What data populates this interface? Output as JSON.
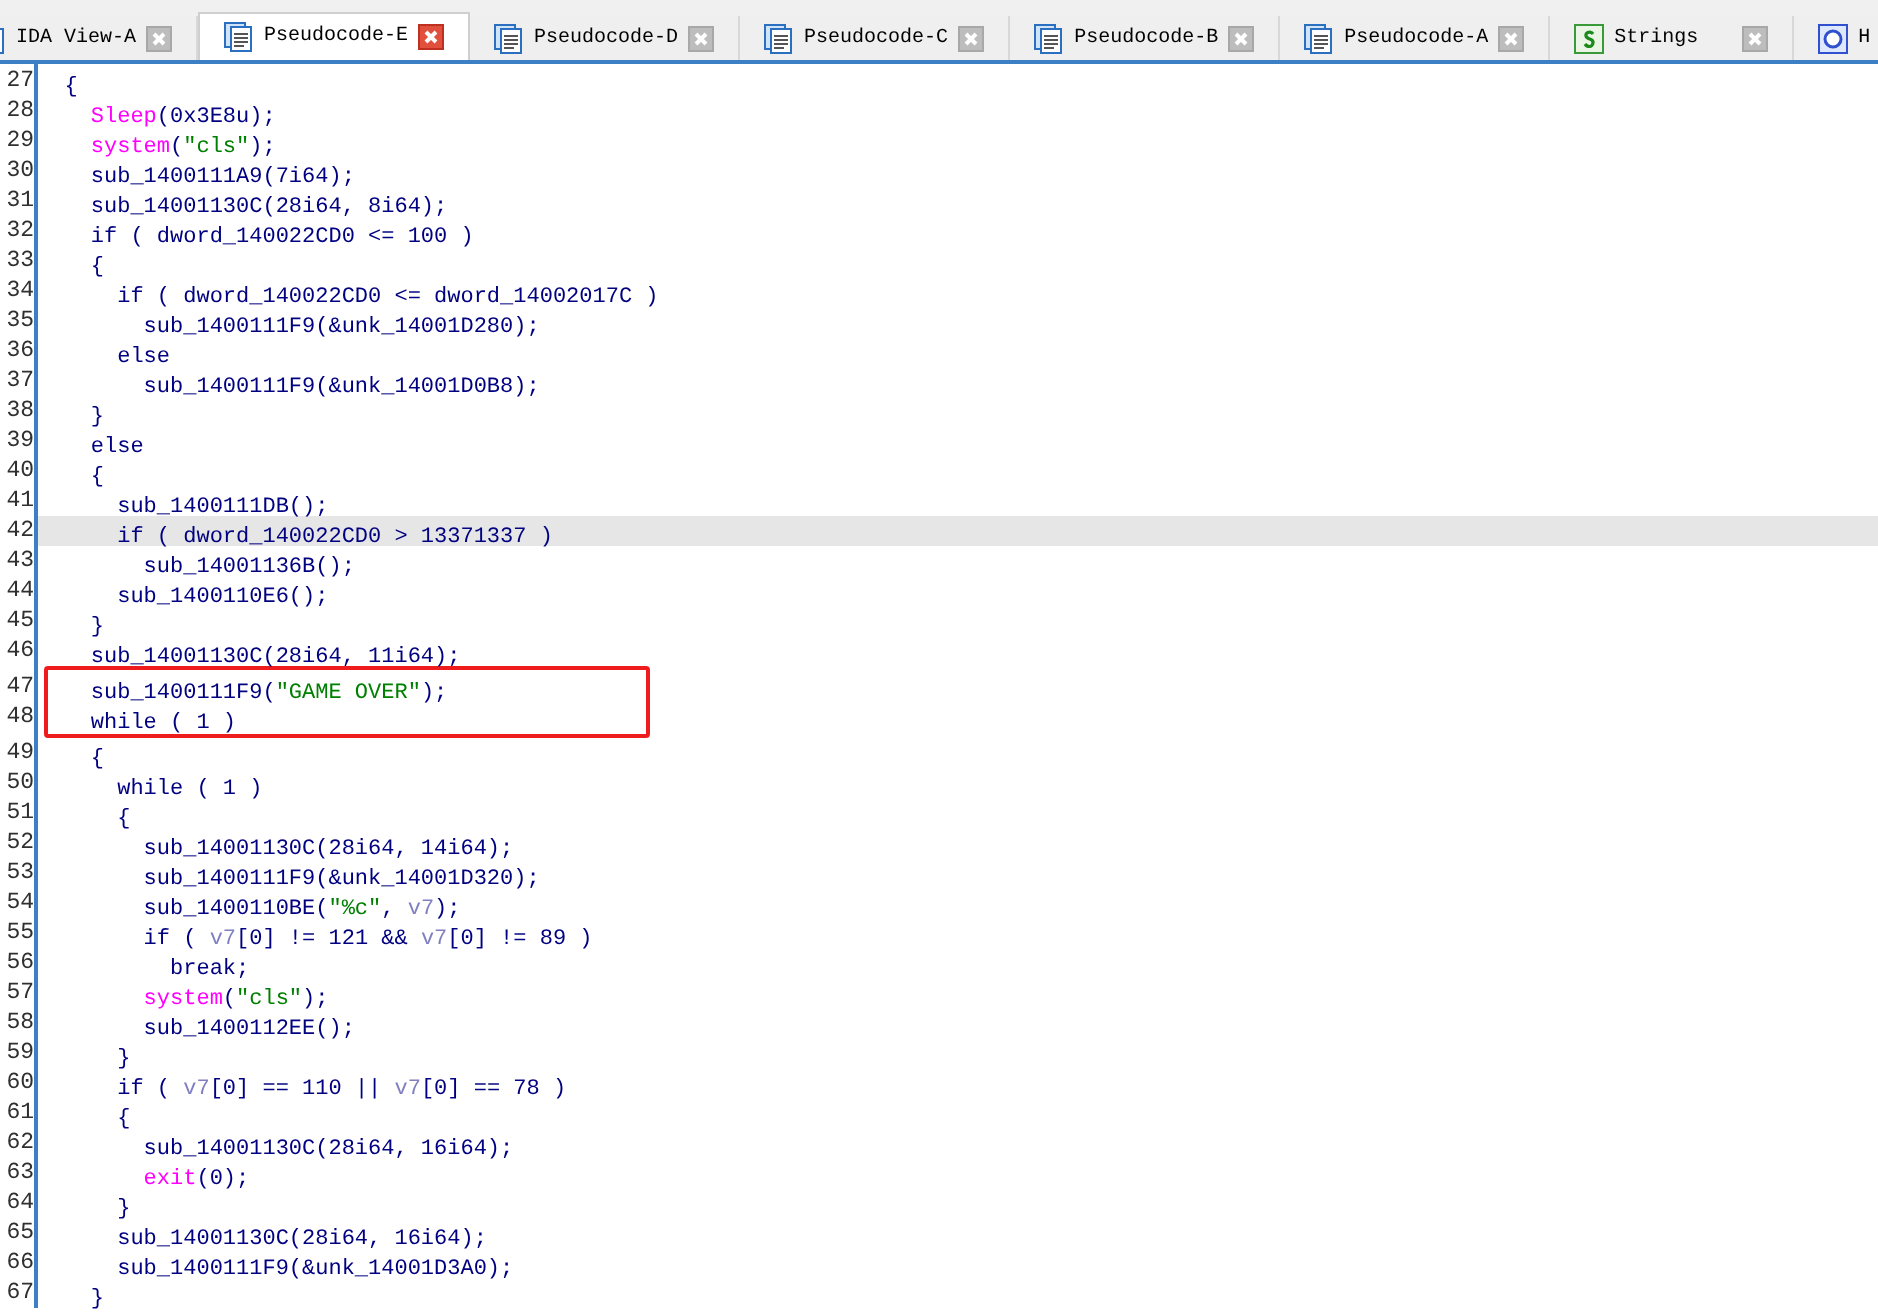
{
  "tabs": [
    {
      "label": "IDA View-A",
      "kind": "document",
      "selected": false
    },
    {
      "label": "Pseudocode-E",
      "kind": "document",
      "selected": true
    },
    {
      "label": "Pseudocode-D",
      "kind": "document",
      "selected": false
    },
    {
      "label": "Pseudocode-C",
      "kind": "document",
      "selected": false
    },
    {
      "label": "Pseudocode-B",
      "kind": "document",
      "selected": false
    },
    {
      "label": "Pseudocode-A",
      "kind": "document",
      "selected": false
    },
    {
      "label": "Strings",
      "kind": "strings",
      "selected": false
    },
    {
      "label": "H",
      "kind": "hex",
      "selected": false
    }
  ],
  "code": {
    "lines": [
      {
        "number": "27",
        "selected": false,
        "boxed": false,
        "tokens": [
          {
            "kind": "code",
            "text": "  {"
          }
        ]
      },
      {
        "number": "28",
        "selected": false,
        "boxed": false,
        "tokens": [
          {
            "kind": "lib",
            "text": "    Sleep"
          },
          {
            "kind": "code",
            "text": "(0x3E8u);"
          }
        ]
      },
      {
        "number": "29",
        "selected": false,
        "boxed": false,
        "tokens": [
          {
            "kind": "lib",
            "text": "    system"
          },
          {
            "kind": "code",
            "text": "("
          },
          {
            "kind": "str",
            "text": "\"cls\""
          },
          {
            "kind": "code",
            "text": ");"
          }
        ]
      },
      {
        "number": "30",
        "selected": false,
        "boxed": false,
        "tokens": [
          {
            "kind": "code",
            "text": "    sub_1400111A9(7i64);"
          }
        ]
      },
      {
        "number": "31",
        "selected": false,
        "boxed": false,
        "tokens": [
          {
            "kind": "code",
            "text": "    sub_14001130C(28i64, 8i64);"
          }
        ]
      },
      {
        "number": "32",
        "selected": false,
        "boxed": false,
        "tokens": [
          {
            "kind": "code",
            "text": "    if ( dword_140022CD0 <= 100 )"
          }
        ]
      },
      {
        "number": "33",
        "selected": false,
        "boxed": false,
        "tokens": [
          {
            "kind": "code",
            "text": "    {"
          }
        ]
      },
      {
        "number": "34",
        "selected": false,
        "boxed": false,
        "tokens": [
          {
            "kind": "code",
            "text": "      if ( dword_140022CD0 <= dword_14002017C )"
          }
        ]
      },
      {
        "number": "35",
        "selected": false,
        "boxed": false,
        "tokens": [
          {
            "kind": "code",
            "text": "        sub_1400111F9(&unk_14001D280);"
          }
        ]
      },
      {
        "number": "36",
        "selected": false,
        "boxed": false,
        "tokens": [
          {
            "kind": "code",
            "text": "      else"
          }
        ]
      },
      {
        "number": "37",
        "selected": false,
        "boxed": false,
        "tokens": [
          {
            "kind": "code",
            "text": "        sub_1400111F9(&unk_14001D0B8);"
          }
        ]
      },
      {
        "number": "38",
        "selected": false,
        "boxed": false,
        "tokens": [
          {
            "kind": "code",
            "text": "    }"
          }
        ]
      },
      {
        "number": "39",
        "selected": false,
        "boxed": false,
        "tokens": [
          {
            "kind": "code",
            "text": "    else"
          }
        ]
      },
      {
        "number": "40",
        "selected": false,
        "boxed": false,
        "tokens": [
          {
            "kind": "code",
            "text": "    {"
          }
        ]
      },
      {
        "number": "41",
        "selected": false,
        "boxed": false,
        "tokens": [
          {
            "kind": "code",
            "text": "      sub_1400111DB();"
          }
        ]
      },
      {
        "number": "42",
        "selected": true,
        "boxed": false,
        "tokens": [
          {
            "kind": "code",
            "text": "      if ( dword_140022CD0 > 13371337 )"
          }
        ]
      },
      {
        "number": "43",
        "selected": false,
        "boxed": false,
        "tokens": [
          {
            "kind": "code",
            "text": "        sub_14001136B();"
          }
        ]
      },
      {
        "number": "44",
        "selected": false,
        "boxed": false,
        "tokens": [
          {
            "kind": "code",
            "text": "      sub_1400110E6();"
          }
        ]
      },
      {
        "number": "45",
        "selected": false,
        "boxed": false,
        "tokens": [
          {
            "kind": "code",
            "text": "    }"
          }
        ]
      },
      {
        "number": "46",
        "selected": false,
        "boxed": false,
        "tokens": [
          {
            "kind": "code",
            "text": "    sub_14001130C(28i64, 11i64);"
          }
        ]
      },
      {
        "number": "47",
        "selected": false,
        "boxed": true,
        "tokens": [
          {
            "kind": "code",
            "text": "    sub_1400111F9("
          },
          {
            "kind": "str",
            "text": "\"GAME OVER\""
          },
          {
            "kind": "code",
            "text": ");"
          }
        ]
      },
      {
        "number": "48",
        "selected": false,
        "boxed": true,
        "tokens": [
          {
            "kind": "code",
            "text": "    while ( 1 )"
          }
        ]
      },
      {
        "number": "49",
        "selected": false,
        "boxed": false,
        "tokens": [
          {
            "kind": "code",
            "text": "    {"
          }
        ]
      },
      {
        "number": "50",
        "selected": false,
        "boxed": false,
        "tokens": [
          {
            "kind": "code",
            "text": "      while ( 1 )"
          }
        ]
      },
      {
        "number": "51",
        "selected": false,
        "boxed": false,
        "tokens": [
          {
            "kind": "code",
            "text": "      {"
          }
        ]
      },
      {
        "number": "52",
        "selected": false,
        "boxed": false,
        "tokens": [
          {
            "kind": "code",
            "text": "        sub_14001130C(28i64, 14i64);"
          }
        ]
      },
      {
        "number": "53",
        "selected": false,
        "boxed": false,
        "tokens": [
          {
            "kind": "code",
            "text": "        sub_1400111F9(&unk_14001D320);"
          }
        ]
      },
      {
        "number": "54",
        "selected": false,
        "boxed": false,
        "tokens": [
          {
            "kind": "code",
            "text": "        sub_1400110BE("
          },
          {
            "kind": "str",
            "text": "\"%c\""
          },
          {
            "kind": "code",
            "text": ", "
          },
          {
            "kind": "var",
            "text": "v7"
          },
          {
            "kind": "code",
            "text": ");"
          }
        ]
      },
      {
        "number": "55",
        "selected": false,
        "boxed": false,
        "tokens": [
          {
            "kind": "code",
            "text": "        if ( "
          },
          {
            "kind": "var",
            "text": "v7"
          },
          {
            "kind": "code",
            "text": "[0] != 121 && "
          },
          {
            "kind": "var",
            "text": "v7"
          },
          {
            "kind": "code",
            "text": "[0] != 89 )"
          }
        ]
      },
      {
        "number": "56",
        "selected": false,
        "boxed": false,
        "tokens": [
          {
            "kind": "code",
            "text": "          break;"
          }
        ]
      },
      {
        "number": "57",
        "selected": false,
        "boxed": false,
        "tokens": [
          {
            "kind": "lib",
            "text": "        system"
          },
          {
            "kind": "code",
            "text": "("
          },
          {
            "kind": "str",
            "text": "\"cls\""
          },
          {
            "kind": "code",
            "text": ");"
          }
        ]
      },
      {
        "number": "58",
        "selected": false,
        "boxed": false,
        "tokens": [
          {
            "kind": "code",
            "text": "        sub_1400112EE();"
          }
        ]
      },
      {
        "number": "59",
        "selected": false,
        "boxed": false,
        "tokens": [
          {
            "kind": "code",
            "text": "      }"
          }
        ]
      },
      {
        "number": "60",
        "selected": false,
        "boxed": false,
        "tokens": [
          {
            "kind": "code",
            "text": "      if ( "
          },
          {
            "kind": "var",
            "text": "v7"
          },
          {
            "kind": "code",
            "text": "[0] == 110 || "
          },
          {
            "kind": "var",
            "text": "v7"
          },
          {
            "kind": "code",
            "text": "[0] == 78 )"
          }
        ]
      },
      {
        "number": "61",
        "selected": false,
        "boxed": false,
        "tokens": [
          {
            "kind": "code",
            "text": "      {"
          }
        ]
      },
      {
        "number": "62",
        "selected": false,
        "boxed": false,
        "tokens": [
          {
            "kind": "code",
            "text": "        sub_14001130C(28i64, 16i64);"
          }
        ]
      },
      {
        "number": "63",
        "selected": false,
        "boxed": false,
        "tokens": [
          {
            "kind": "lib",
            "text": "        exit"
          },
          {
            "kind": "code",
            "text": "(0);"
          }
        ]
      },
      {
        "number": "64",
        "selected": false,
        "boxed": false,
        "tokens": [
          {
            "kind": "code",
            "text": "      }"
          }
        ]
      },
      {
        "number": "65",
        "selected": false,
        "boxed": false,
        "tokens": [
          {
            "kind": "code",
            "text": "      sub_14001130C(28i64, 16i64);"
          }
        ]
      },
      {
        "number": "66",
        "selected": false,
        "boxed": false,
        "tokens": [
          {
            "kind": "code",
            "text": "      sub_1400111F9(&unk_14001D3A0);"
          }
        ]
      },
      {
        "number": "67",
        "selected": false,
        "boxed": false,
        "tokens": [
          {
            "kind": "code",
            "text": "    }"
          }
        ]
      }
    ]
  }
}
